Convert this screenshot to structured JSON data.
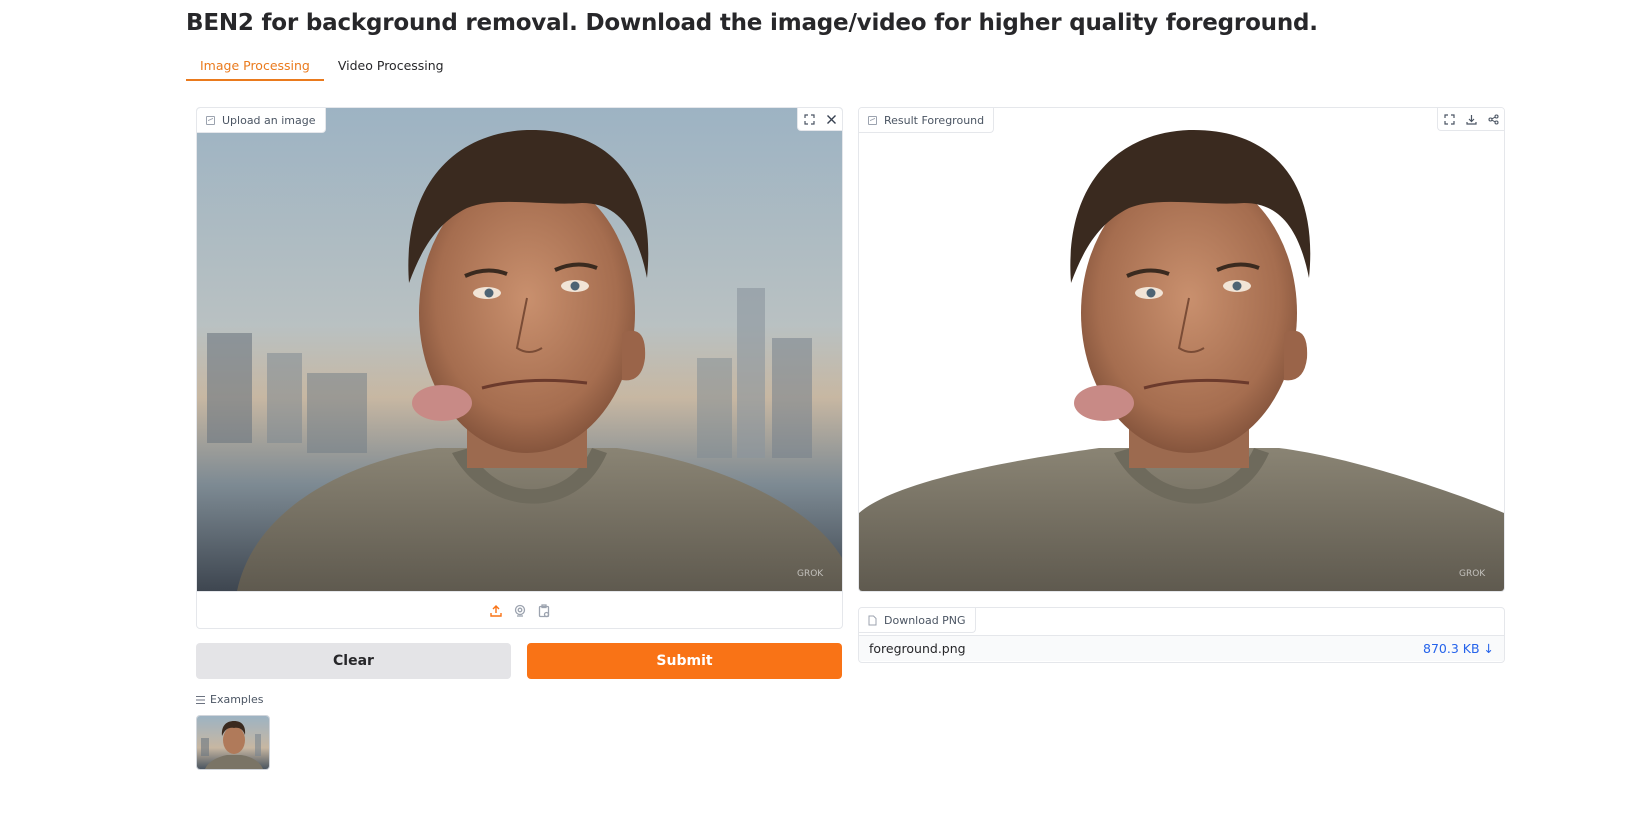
{
  "header": {
    "title": "BEN2 for background removal. Download the image/video for higher quality foreground."
  },
  "tabs": [
    {
      "label": "Image Processing",
      "active": true
    },
    {
      "label": "Video Processing",
      "active": false
    }
  ],
  "input_panel": {
    "label": "Upload an image",
    "icons": [
      "fullscreen-icon",
      "close-icon"
    ],
    "toolbar_icons": [
      "upload-icon",
      "webcam-icon",
      "clipboard-icon"
    ]
  },
  "output_panel": {
    "label": "Result Foreground",
    "icons": [
      "fullscreen-icon",
      "download-icon",
      "share-icon"
    ]
  },
  "buttons": {
    "clear": "Clear",
    "submit": "Submit"
  },
  "examples": {
    "label": "Examples"
  },
  "download": {
    "label": "Download PNG",
    "file_name": "foreground.png",
    "file_size": "870.3 KB ↓"
  },
  "colors": {
    "accent": "#f97316",
    "tab_active": "#ea7a1d",
    "link": "#2563eb"
  }
}
